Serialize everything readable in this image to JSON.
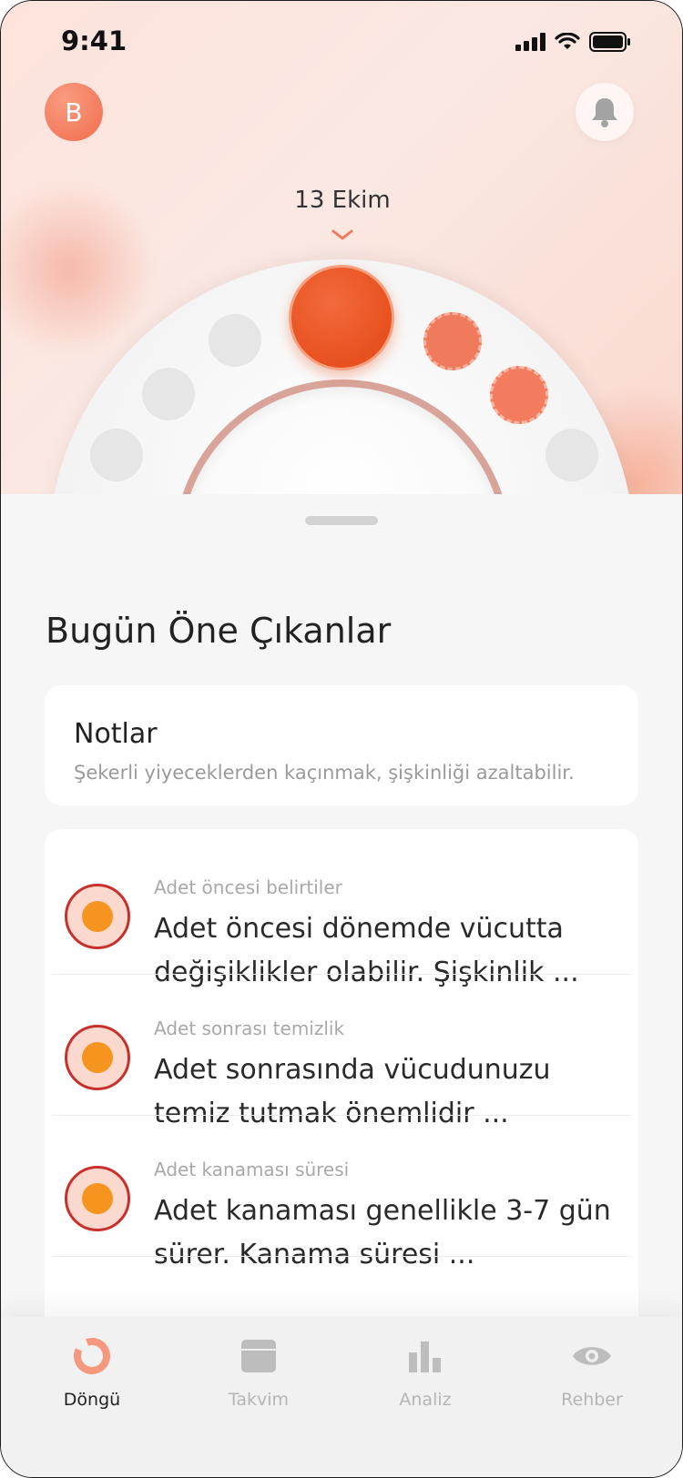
{
  "status_bar": {
    "time": "9:41"
  },
  "header": {
    "avatar_initial": "B"
  },
  "cycle": {
    "selected_date": "13 Ekim"
  },
  "highlights": {
    "title": "Bugün Öne Çıkanlar",
    "notes": {
      "title": "Notlar",
      "text": "Şekerli yiyeceklerden kaçınmak, şişkinliği azaltabilir."
    },
    "items": [
      {
        "category": "Adet öncesi belirtiler",
        "text": "Adet öncesi dönemde vücutta değişiklikler olabilir. Şişkinlik ..."
      },
      {
        "category": "Adet sonrası temizlik",
        "text": "Adet sonrasında vücudunuzu temiz tutmak önemlidir ..."
      },
      {
        "category": "Adet kanaması süresi",
        "text": "Adet kanaması genellikle 3-7 gün sürer. Kanama süresi ..."
      }
    ]
  },
  "tabbar": {
    "tabs": [
      {
        "label": "Döngü",
        "icon": "cycle-icon",
        "active": true
      },
      {
        "label": "Takvim",
        "icon": "calendar-icon",
        "active": false
      },
      {
        "label": "Analiz",
        "icon": "bar-chart-icon",
        "active": false
      },
      {
        "label": "Rehber",
        "icon": "eye-icon",
        "active": false
      }
    ]
  },
  "colors": {
    "accent": "#ef6a45",
    "icon_ring": "#c9302c",
    "icon_fill": "#f5951f"
  }
}
